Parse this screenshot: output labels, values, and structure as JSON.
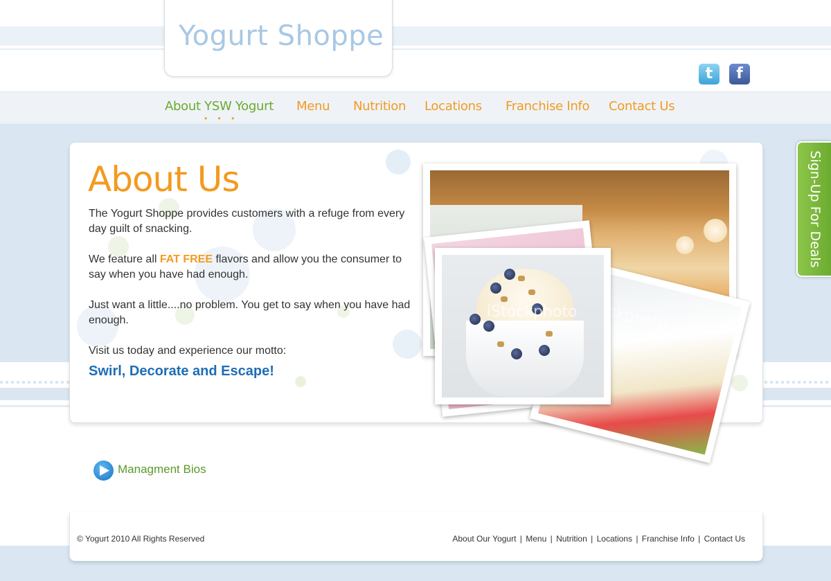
{
  "brand": {
    "logo": "Yogurt Shoppe"
  },
  "social": {
    "twitter_glyph": "t",
    "facebook_glyph": "f"
  },
  "nav": {
    "items": [
      {
        "label": "About YSW Yogurt",
        "active": true
      },
      {
        "label": "Menu"
      },
      {
        "label": "Nutrition"
      },
      {
        "label": "Locations"
      },
      {
        "label": "Franchise Info"
      },
      {
        "label": "Contact Us"
      }
    ],
    "active_indicator": "• • •"
  },
  "main": {
    "heading": "About Us",
    "para1": "The Yogurt Shoppe provides customers with a refuge from every day guilt of snacking.",
    "para2_before": "We feature all ",
    "para2_highlight": "FAT FREE",
    "para2_after": " flavors and allow you the consumer to say when you have had enough.",
    "para3": "Just want a little....no problem. You get to say when you have had enough.",
    "para4": "Visit us today and experience our motto:",
    "motto": "Swirl, Decorate and Escape!"
  },
  "photos": {
    "watermark": "iStockphoto"
  },
  "signup": {
    "label": "Sign-Up For Deals"
  },
  "bios": {
    "label": "Managment Bios"
  },
  "footer": {
    "copyright": "© Yogurt 2010 All Rights Reserved",
    "links": [
      "About Our Yogurt",
      "Menu",
      "Nutrition",
      "Locations",
      "Franchise Info",
      "Contact Us"
    ],
    "separator": "|"
  },
  "colors": {
    "accent_orange": "#f39a1f",
    "accent_green": "#6aaa2f",
    "motto_blue": "#1e6db5",
    "band_blue": "#dae7f2"
  }
}
